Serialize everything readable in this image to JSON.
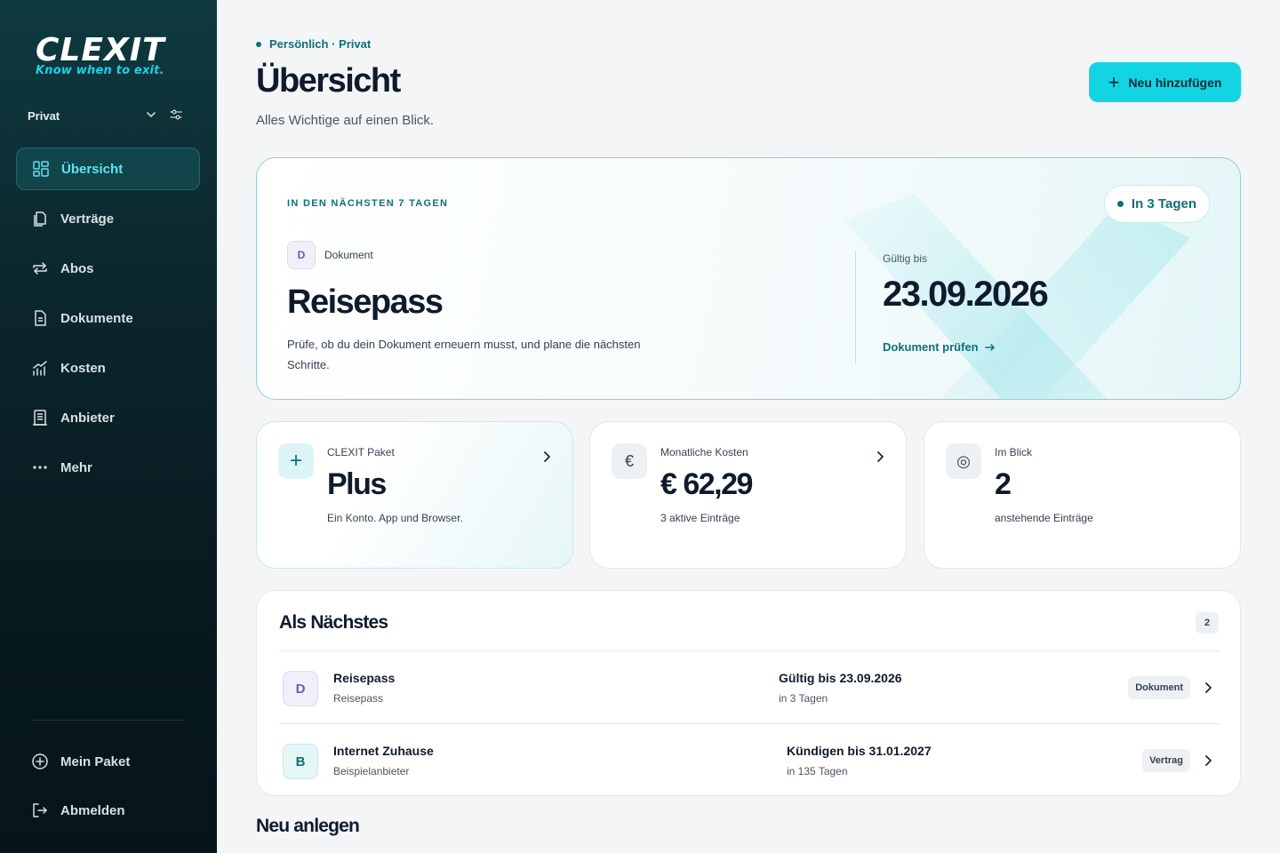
{
  "app": {
    "logo_word": "CLEXIT",
    "logo_tagline": "Know when to exit."
  },
  "sidebar": {
    "workspace": "Privat",
    "items": [
      {
        "label": "Übersicht",
        "icon": "dashboard-icon",
        "active": true
      },
      {
        "label": "Verträge",
        "icon": "contracts-icon"
      },
      {
        "label": "Abos",
        "icon": "subscriptions-icon"
      },
      {
        "label": "Dokumente",
        "icon": "document-icon"
      },
      {
        "label": "Kosten",
        "icon": "costs-chart-icon"
      },
      {
        "label": "Anbieter",
        "icon": "provider-building-icon"
      },
      {
        "label": "Mehr",
        "icon": "more-dots-icon"
      }
    ],
    "bottom": [
      {
        "label": "Mein Paket",
        "icon": "plus-circle-icon"
      },
      {
        "label": "Abmelden",
        "icon": "logout-icon"
      }
    ]
  },
  "header": {
    "breadcrumb": "Persönlich · Privat",
    "title": "Übersicht",
    "subtitle": "Alles Wichtige auf einen Blick.",
    "add_button": "Neu hinzufügen"
  },
  "hero": {
    "kicker": "IN DEN NÄCHSTEN 7 TAGEN",
    "badge": "In 3 Tagen",
    "type_letter": "D",
    "type_label": "Dokument",
    "title": "Reisepass",
    "description": "Prüfe, ob du dein Dokument erneuern musst, und plane die nächsten Schritte.",
    "valid_label": "Gültig bis",
    "valid_date": "23.09.2026",
    "link": "Dokument prüfen"
  },
  "stats": [
    {
      "icon_glyph": "+",
      "icon": "plus-icon",
      "label": "CLEXIT Paket",
      "value": "Plus",
      "sub": "Ein Konto. App und Browser."
    },
    {
      "icon_glyph": "€",
      "icon": "euro-icon",
      "label": "Monatliche Kosten",
      "value": "€ 62,29",
      "sub": "3 aktive Einträge"
    },
    {
      "icon_glyph": "◎",
      "icon": "target-icon",
      "label": "Im Blick",
      "value": "2",
      "sub": "anstehende Einträge"
    }
  ],
  "next": {
    "title": "Als Nächstes",
    "count": "2",
    "rows": [
      {
        "letter": "D",
        "title": "Reisepass",
        "sub": "Reisepass",
        "date": "Gültig bis 23.09.2026",
        "days": "in 3 Tagen",
        "tag": "Dokument"
      },
      {
        "letter": "B",
        "title": "Internet Zuhause",
        "sub": "Beispielanbieter",
        "date": "Kündigen bis 31.01.2027",
        "days": "in 135 Tagen",
        "tag": "Vertrag"
      }
    ]
  },
  "new_section": {
    "title": "Neu anlegen"
  },
  "colors": {
    "accent": "#12d4e3",
    "brand_teal": "#0f6f78",
    "sidebar_bg": "#0b262c"
  }
}
